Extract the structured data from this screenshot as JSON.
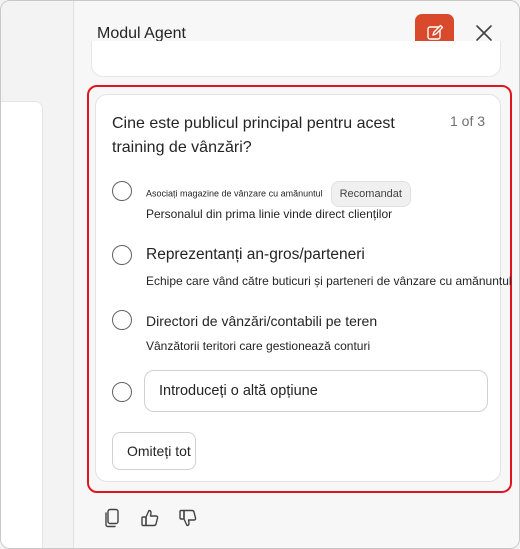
{
  "header": {
    "title": "Modul Agent"
  },
  "question": {
    "text": "Cine este publicul principal pentru acest training de vânzări?",
    "counter": "1 of 3"
  },
  "options": [
    {
      "title": "Asociați magazine de vânzare cu amănuntul",
      "badge": "Recomandat",
      "description": "Personalul din prima linie vinde direct clienților"
    },
    {
      "title": "Reprezentanți an-gros/parteneri",
      "description": "Echipe care vând către buticuri și parteneri de vânzare cu amănuntul"
    },
    {
      "title": "Directori de vânzări/contabili pe teren",
      "description": "Vânzătorii teritori care gestionează conturi"
    }
  ],
  "other_option": {
    "placeholder": "Introduceți o altă opțiune"
  },
  "skip_button": {
    "label": "Omiteți tot"
  },
  "icons": {
    "new_chat": "edit-square-icon",
    "close": "close-icon",
    "copy": "copy-icon",
    "thumbs_up": "thumbs-up-icon",
    "thumbs_down": "thumbs-down-icon"
  },
  "colors": {
    "accent": "#d84a2b",
    "highlight": "#e0161e"
  }
}
